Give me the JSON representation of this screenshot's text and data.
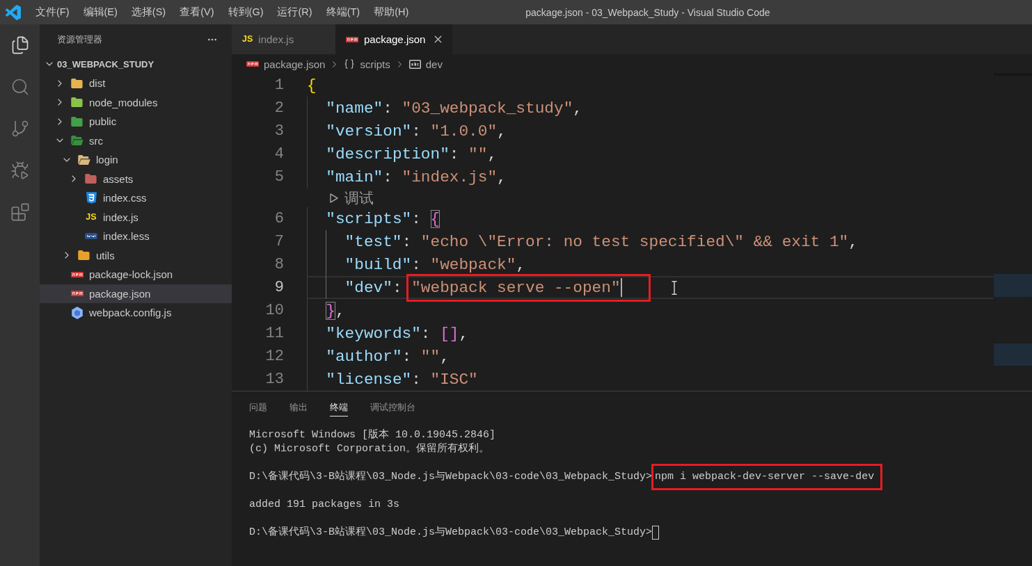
{
  "window": {
    "menu": [
      "文件(F)",
      "编辑(E)",
      "选择(S)",
      "查看(V)",
      "转到(G)",
      "运行(R)",
      "终端(T)",
      "帮助(H)"
    ],
    "title": "package.json - 03_Webpack_Study - Visual Studio Code"
  },
  "activity_bar": [
    {
      "kind": "explorer",
      "selected": true
    },
    {
      "kind": "search",
      "selected": false
    },
    {
      "kind": "scm",
      "selected": false
    },
    {
      "kind": "debug",
      "selected": false
    },
    {
      "kind": "extensions",
      "selected": false
    }
  ],
  "sidebar": {
    "title": "资源管理器",
    "section": {
      "label": "03_WEBPACK_STUDY",
      "expanded": true
    },
    "tree": [
      {
        "kind": "folder",
        "label": "dist",
        "color": "#e3b552",
        "expanded": false,
        "selected": false
      },
      {
        "kind": "folder",
        "label": "node_modules",
        "color": "#8bc34a",
        "expanded": false,
        "selected": false
      },
      {
        "kind": "folder",
        "label": "public",
        "color": "#43a047",
        "expanded": false,
        "selected": false
      },
      {
        "kind": "folder",
        "label": "src",
        "color": "#388e3c",
        "expanded": true,
        "selected": false,
        "children": [
          {
            "kind": "folder",
            "label": "login",
            "color": "#d9b77e",
            "expanded": true,
            "selected": false,
            "children": [
              {
                "kind": "folder",
                "label": "assets",
                "color": "#c0605c",
                "expanded": false,
                "selected": false
              },
              {
                "kind": "css",
                "label": "index.css",
                "selected": false
              },
              {
                "kind": "js",
                "type_label": "JS",
                "label": "index.js",
                "selected": false
              },
              {
                "kind": "less",
                "label": "index.less",
                "selected": false
              }
            ]
          },
          {
            "kind": "folder",
            "label": "utils",
            "color": "#e8a128",
            "expanded": false,
            "selected": false
          }
        ]
      },
      {
        "kind": "npm",
        "label": "package-lock.json",
        "selected": false
      },
      {
        "kind": "npm",
        "label": "package.json",
        "selected": true
      },
      {
        "kind": "webpack",
        "label": "webpack.config.js",
        "selected": false
      }
    ]
  },
  "editor": {
    "tabs": [
      {
        "kind": "js",
        "type_label": "JS",
        "label": "index.js",
        "selected": false
      },
      {
        "kind": "npm",
        "label": "package.json",
        "selected": true
      }
    ],
    "breadcrumbs": [
      {
        "kind": "npm",
        "label": "package.json"
      },
      {
        "kind": "object",
        "label": "scripts"
      },
      {
        "kind": "string",
        "label": "dev"
      }
    ],
    "lines": [
      {
        "number": "1",
        "current": false,
        "tokens": [
          {
            "kind": "brace1",
            "text": "{"
          }
        ]
      },
      {
        "number": "2",
        "current": false,
        "tokens": [
          {
            "kind": "key",
            "text": "  \"name\""
          },
          {
            "kind": "punct",
            "text": ": "
          },
          {
            "kind": "string",
            "text": "\"03_webpack_study\""
          },
          {
            "kind": "punct",
            "text": ","
          }
        ]
      },
      {
        "number": "3",
        "current": false,
        "tokens": [
          {
            "kind": "key",
            "text": "  \"version\""
          },
          {
            "kind": "punct",
            "text": ": "
          },
          {
            "kind": "string",
            "text": "\"1.0.0\""
          },
          {
            "kind": "punct",
            "text": ","
          }
        ]
      },
      {
        "number": "4",
        "current": false,
        "tokens": [
          {
            "kind": "key",
            "text": "  \"description\""
          },
          {
            "kind": "punct",
            "text": ": "
          },
          {
            "kind": "string",
            "text": "\"\""
          },
          {
            "kind": "punct",
            "text": ","
          }
        ]
      },
      {
        "number": "5",
        "current": false,
        "tokens": [
          {
            "kind": "key",
            "text": "  \"main\""
          },
          {
            "kind": "punct",
            "text": ": "
          },
          {
            "kind": "string",
            "text": "\"index.js\""
          },
          {
            "kind": "punct",
            "text": ","
          }
        ]
      },
      {
        "number": "6",
        "current": false,
        "codelens": "调试",
        "tokens": [
          {
            "kind": "key",
            "text": "  \"scripts\""
          },
          {
            "kind": "punct",
            "text": ": "
          },
          {
            "kind": "bracematch",
            "text": "{"
          }
        ]
      },
      {
        "number": "7",
        "current": false,
        "tokens": [
          {
            "kind": "key",
            "text": "    \"test\""
          },
          {
            "kind": "punct",
            "text": ": "
          },
          {
            "kind": "string",
            "text": "\"echo \\\"Error: no test specified\\\" && exit 1\""
          },
          {
            "kind": "punct",
            "text": ","
          }
        ]
      },
      {
        "number": "8",
        "current": false,
        "tokens": [
          {
            "kind": "key",
            "text": "    \"build\""
          },
          {
            "kind": "punct",
            "text": ": "
          },
          {
            "kind": "string",
            "text": "\"webpack\""
          },
          {
            "kind": "punct",
            "text": ","
          }
        ]
      },
      {
        "number": "9",
        "current": true,
        "tokens": [
          {
            "kind": "key",
            "text": "    \"dev\""
          },
          {
            "kind": "punct",
            "text": ": "
          }
        ],
        "boxed": [
          {
            "kind": "string",
            "text": "\"webpack serve --open\""
          }
        ]
      },
      {
        "number": "10",
        "current": false,
        "tokens": [
          {
            "kind": "bracematch",
            "text": "  }"
          },
          {
            "kind": "punct",
            "text": ","
          }
        ]
      },
      {
        "number": "11",
        "current": false,
        "tokens": [
          {
            "kind": "key",
            "text": "  \"keywords\""
          },
          {
            "kind": "punct",
            "text": ": "
          },
          {
            "kind": "brace2",
            "text": "[]"
          },
          {
            "kind": "punct",
            "text": ","
          }
        ]
      },
      {
        "number": "12",
        "current": false,
        "tokens": [
          {
            "kind": "key",
            "text": "  \"author\""
          },
          {
            "kind": "punct",
            "text": ": "
          },
          {
            "kind": "string",
            "text": "\"\""
          },
          {
            "kind": "punct",
            "text": ","
          }
        ]
      },
      {
        "number": "13",
        "current": false,
        "tokens": [
          {
            "kind": "key",
            "text": "  \"license\""
          },
          {
            "kind": "punct",
            "text": ": "
          },
          {
            "kind": "string",
            "text": "\"ISC\""
          }
        ]
      }
    ]
  },
  "panel": {
    "tabs": [
      {
        "label": "问题",
        "selected": false
      },
      {
        "label": "输出",
        "selected": false
      },
      {
        "label": "终端",
        "selected": true
      },
      {
        "label": "调试控制台",
        "selected": false
      }
    ],
    "terminal": [
      {
        "kind": "output",
        "lines": [
          "Microsoft Windows [版本 10.0.19045.2846]",
          "(c) Microsoft Corporation。保留所有权利。"
        ]
      },
      {
        "kind": "command",
        "prompt": "D:\\备课代码\\3-B站课程\\03_Node.js与Webpack\\03-code\\03_Webpack_Study>",
        "command": "npm i webpack-dev-server --save-dev",
        "boxed": true
      },
      {
        "kind": "output",
        "lines": [
          "added 191 packages in 3s"
        ]
      },
      {
        "kind": "prompt",
        "prompt": "D:\\备课代码\\3-B站课程\\03_Node.js与Webpack\\03-code\\03_Webpack_Study>",
        "cursor": true
      }
    ]
  }
}
